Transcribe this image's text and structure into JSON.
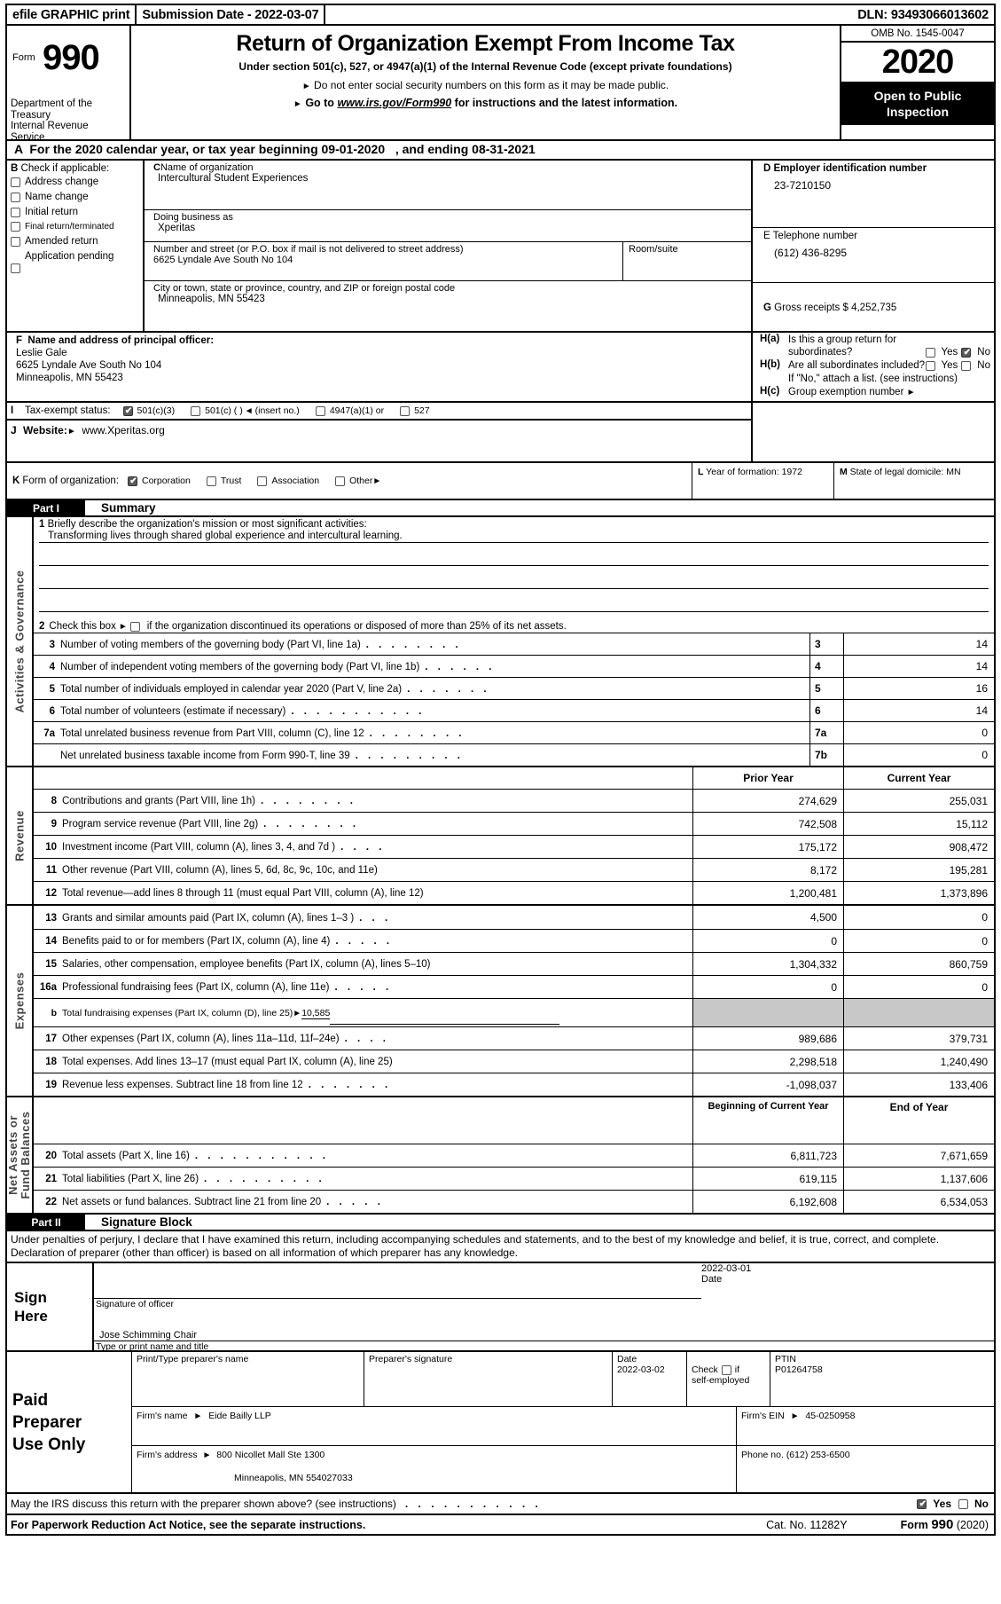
{
  "efile": {
    "graphic_print": "efile GRAPHIC print",
    "submission": "Submission Date - 2022-03-07",
    "dln": "DLN: 93493066013602"
  },
  "header": {
    "form_label": "Form",
    "form_number": "990",
    "title": "Return of Organization Exempt From Income Tax",
    "subtitle1": "Under section 501(c), 527, or 4947(a)(1) of the Internal Revenue Code (except private foundations)",
    "subtitle2": "Do not enter social security numbers on this form as it may be made public.",
    "subtitle3_pre": "Go to",
    "subtitle3_link": "www.irs.gov/Form990",
    "subtitle3_post": "for instructions and the latest information.",
    "department": "Department of the Treasury Internal Revenue Service",
    "omb": "OMB No. 1545-0047",
    "year": "2020",
    "open_to_public": "Open to Public Inspection"
  },
  "lineA": {
    "letter": "A",
    "text_pre": "For the 2020 calendar year, or tax year beginning",
    "begin_date": "09-01-2020",
    "text_mid": ", and ending",
    "end_date": "08-31-2021"
  },
  "sectionB": {
    "letter": "B",
    "heading": "Check if applicable:",
    "items": [
      {
        "label": "Address change",
        "checked": false
      },
      {
        "label": "Name change",
        "checked": false
      },
      {
        "label": "Initial return",
        "checked": false
      },
      {
        "label": "Final return/terminated",
        "checked": false
      },
      {
        "label": "Amended return",
        "checked": false
      },
      {
        "label": "Application pending",
        "checked": false
      }
    ]
  },
  "sectionC": {
    "letter": "C",
    "name_label": "Name of organization",
    "name_value": "Intercultural Student Experiences",
    "dba_label": "Doing business as",
    "dba_value": "Xperitas",
    "street_label": "Number and street (or P.O. box if mail is not delivered to street address)",
    "street_value": "6625 Lyndale Ave South No 104",
    "room_label": "Room/suite",
    "room_value": "",
    "city_label": "City or town, state or province, country, and ZIP or foreign postal code",
    "city_value": "Minneapolis, MN  55423"
  },
  "sectionD": {
    "letter": "D",
    "ein_label": "Employer identification number",
    "ein_value": "23-7210150",
    "phone_letter": "E",
    "phone_label": "Telephone number",
    "phone_value": "(612) 436-8295",
    "gross_letter": "G",
    "gross_label": "Gross receipts $",
    "gross_value": "4,252,735"
  },
  "sectionF": {
    "letter": "F",
    "label": "Name and address of principal officer:",
    "officer_name": "Leslie Gale",
    "officer_street": "6625 Lyndale Ave South No 104",
    "officer_city": "Minneapolis, MN  55423"
  },
  "sectionH": {
    "ha_label": "H(a)",
    "ha_text": "Is this a group return for subordinates?",
    "ha_yes": "Yes",
    "ha_no": "No",
    "ha_answer": "No",
    "hb_label": "H(b)",
    "hb_text": "Are all subordinates included?",
    "hb_yes": "Yes",
    "hb_no": "No",
    "hb_answer": "",
    "hb_note": "If \"No,\" attach a list. (see instructions)",
    "hc_label": "H(c)",
    "hc_text": "Group exemption number",
    "hc_value": ""
  },
  "sectionI": {
    "letter": "I",
    "label": "Tax-exempt status:",
    "options": [
      {
        "label": "501(c)(3)",
        "checked": true
      },
      {
        "label": "501(c) (  )",
        "checked": false,
        "suffix": "(insert no.)"
      },
      {
        "label": "4947(a)(1) or",
        "checked": false
      },
      {
        "label": "527",
        "checked": false
      }
    ]
  },
  "sectionJ": {
    "letter": "J",
    "label": "Website:",
    "value": "www.Xperitas.org"
  },
  "sectionK": {
    "letter": "K",
    "label": "Form of organization:",
    "options": [
      {
        "label": "Corporation",
        "checked": true
      },
      {
        "label": "Trust",
        "checked": false
      },
      {
        "label": "Association",
        "checked": false
      },
      {
        "label": "Other",
        "checked": false
      }
    ]
  },
  "sectionL": {
    "letter": "L",
    "label": "Year of formation:",
    "value": "1972"
  },
  "sectionM": {
    "letter": "M",
    "label": "State of legal domicile:",
    "value": "MN"
  },
  "partI": {
    "bar_num": "Part I",
    "bar_title": "Summary",
    "sidebands": {
      "activities": "Activities & Governance",
      "revenue": "Revenue",
      "expenses": "Expenses",
      "netassets": "Net Assets or Fund Balances"
    },
    "line1_label": "Briefly describe the organization's mission or most significant activities:",
    "line1_num": "1",
    "mission": "Transforming lives through shared global experience and intercultural learning.",
    "line2_num": "2",
    "line2_pre": "Check this box",
    "line2_post": "if the organization discontinued its operations or disposed of more than 25% of its net assets.",
    "gov_rows": [
      {
        "num": "3",
        "text": "Number of voting members of the governing body (Part VI, line 1a)",
        "code": "3",
        "value": "14"
      },
      {
        "num": "4",
        "text": "Number of independent voting members of the governing body (Part VI, line 1b)",
        "code": "4",
        "value": "14"
      },
      {
        "num": "5",
        "text": "Total number of individuals employed in calendar year 2020 (Part V, line 2a)",
        "code": "5",
        "value": "16"
      },
      {
        "num": "6",
        "text": "Total number of volunteers (estimate if necessary)",
        "code": "6",
        "value": "14"
      },
      {
        "num": "7a",
        "text": "Total unrelated business revenue from Part VIII, column (C), line 12",
        "code": "7a",
        "value": "0"
      },
      {
        "num": "",
        "text": "Net unrelated business taxable income from Form 990-T, line 39",
        "code": "7b",
        "value": "0"
      }
    ],
    "col_prior": "Prior Year",
    "col_current": "Current Year",
    "revenue_rows": [
      {
        "num": "8",
        "text": "Contributions and grants (Part VIII, line 1h)",
        "prior": "274,629",
        "current": "255,031"
      },
      {
        "num": "9",
        "text": "Program service revenue (Part VIII, line 2g)",
        "prior": "742,508",
        "current": "15,112"
      },
      {
        "num": "10",
        "text": "Investment income (Part VIII, column (A), lines 3, 4, and 7d )",
        "prior": "175,172",
        "current": "908,472"
      },
      {
        "num": "11",
        "text": "Other revenue (Part VIII, column (A), lines 5, 6d, 8c, 9c, 10c, and 11e)",
        "prior": "8,172",
        "current": "195,281",
        "nodots": true
      },
      {
        "num": "12",
        "text": "Total revenue—add lines 8 through 11 (must equal Part VIII, column (A), line 12)",
        "prior": "1,200,481",
        "current": "1,373,896",
        "nodots": true
      }
    ],
    "expense_rows": [
      {
        "num": "13",
        "text": "Grants and similar amounts paid (Part IX, column (A), lines 1–3 )",
        "prior": "4,500",
        "current": "0"
      },
      {
        "num": "14",
        "text": "Benefits paid to or for members (Part IX, column (A), line 4)",
        "prior": "0",
        "current": "0"
      },
      {
        "num": "15",
        "text": "Salaries, other compensation, employee benefits (Part IX, column (A), lines 5–10)",
        "prior": "1,304,332",
        "current": "860,759",
        "nodots": true
      },
      {
        "num": "16a",
        "text": "Professional fundraising fees (Part IX, column (A), line 11e)",
        "prior": "0",
        "current": "0"
      }
    ],
    "fundraising_sub": {
      "num": "b",
      "text": "Total fundraising expenses (Part IX, column (D), line 25)",
      "value": "10,585"
    },
    "expense_rows2": [
      {
        "num": "17",
        "text": "Other expenses (Part IX, column (A), lines 11a–11d, 11f–24e)",
        "prior": "989,686",
        "current": "379,731"
      },
      {
        "num": "18",
        "text": "Total expenses. Add lines 13–17 (must equal Part IX, column (A), line 25)",
        "prior": "2,298,518",
        "current": "1,240,490",
        "nodots": true
      },
      {
        "num": "19",
        "text": "Revenue less expenses. Subtract line 18 from line 12",
        "prior": "-1,098,037",
        "current": "133,406"
      }
    ],
    "col_begin": "Beginning of Current Year",
    "col_end": "End of Year",
    "net_rows": [
      {
        "num": "20",
        "text": "Total assets (Part X, line 16)",
        "prior": "6,811,723",
        "current": "7,671,659"
      },
      {
        "num": "21",
        "text": "Total liabilities (Part X, line 26)",
        "prior": "619,115",
        "current": "1,137,606"
      },
      {
        "num": "22",
        "text": "Net assets or fund balances. Subtract line 21 from line 20",
        "prior": "6,192,608",
        "current": "6,534,053"
      }
    ]
  },
  "partII": {
    "bar_num": "Part II",
    "bar_title": "Signature Block",
    "perjury": "Under penalties of perjury, I declare that I have examined this return, including accompanying schedules and statements, and to the best of my knowledge and belief, it is true, correct, and complete. Declaration of preparer (other than officer) is based on all information of which preparer has any knowledge.",
    "sign_here": "Sign Here",
    "sig_officer_label": "Signature of officer",
    "sig_officer_value": "",
    "date_label": "Date",
    "date_value": "2022-03-01",
    "name_title_label": "Type or print name and title",
    "name_title_value": "Jose Schimming  Chair"
  },
  "preparer": {
    "block_label": "Paid Preparer Use Only",
    "print_name_label": "Print/Type preparer's name",
    "print_name_value": "",
    "signature_label": "Preparer's signature",
    "signature_value": "",
    "date_label": "Date",
    "date_value": "2022-03-02",
    "check_label": "Check",
    "check_if": "if",
    "self_employed": "self-employed",
    "self_employed_checked": false,
    "ptin_label": "PTIN",
    "ptin_value": "P01264758",
    "firm_name_label": "Firm's name",
    "firm_name_value": "Eide Bailly LLP",
    "firm_ein_label": "Firm's EIN",
    "firm_ein_value": "45-0250958",
    "firm_address_label": "Firm's address",
    "firm_address_value": "800 Nicollet Mall Ste 1300",
    "firm_address_city": "Minneapolis, MN  554027033",
    "phone_label": "Phone no.",
    "phone_value": "(612) 253-6500"
  },
  "discuss": {
    "text": "May the IRS discuss this return with the preparer shown above? (see instructions)",
    "yes": "Yes",
    "no": "No",
    "answer": "Yes"
  },
  "footer": {
    "notice": "For Paperwork Reduction Act Notice, see the separate instructions.",
    "cat": "Cat. No. 11282Y",
    "form_pre": "Form",
    "form_num": "990",
    "form_year": "(2020)"
  }
}
